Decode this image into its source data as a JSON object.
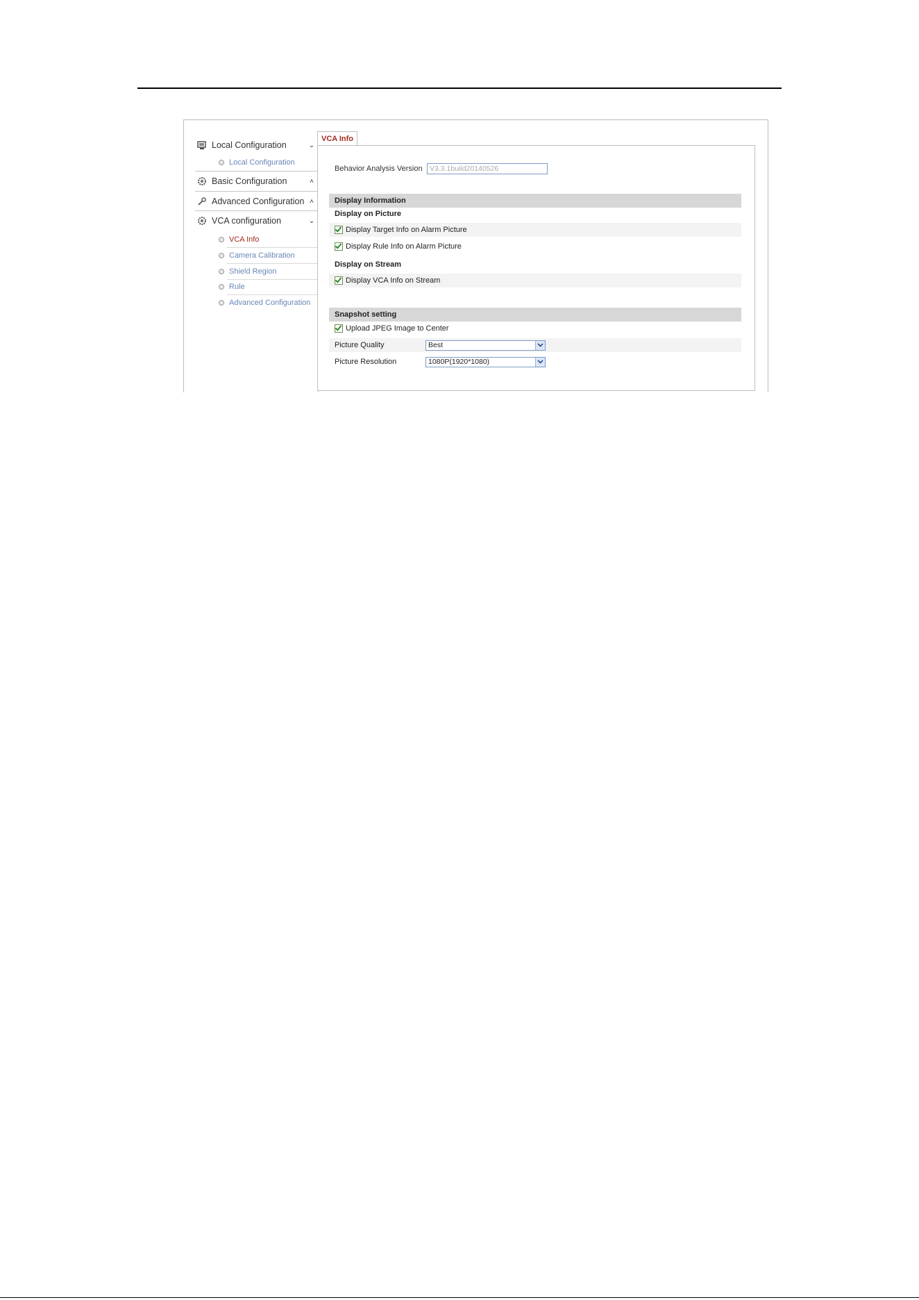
{
  "sidebar": {
    "sections": [
      {
        "label": "Local Configuration",
        "icon": "monitor-icon",
        "chevron": "⌄"
      },
      {
        "label": "Basic Configuration",
        "icon": "gear-icon",
        "chevron": "˄"
      },
      {
        "label": "Advanced Configuration",
        "icon": "wrench-icon",
        "chevron": "˄"
      },
      {
        "label": "VCA configuration",
        "icon": "gear-icon",
        "chevron": "⌄"
      }
    ],
    "local_items": [
      "Local Configuration"
    ],
    "vca_items": [
      "VCA Info",
      "Camera Calibration",
      "Shield Region",
      "Rule",
      "Advanced Configuration"
    ],
    "active_item": "VCA Info"
  },
  "tab": {
    "label": "VCA Info"
  },
  "version": {
    "label": "Behavior Analysis Version",
    "value": "V3.3.1build20140526"
  },
  "display_information": {
    "title": "Display Information",
    "picture_title": "Display on Picture",
    "picture_options": [
      "Display Target Info on Alarm Picture",
      "Display Rule Info on Alarm Picture"
    ],
    "stream_title": "Display on Stream",
    "stream_options": [
      "Display VCA Info on Stream"
    ]
  },
  "snapshot": {
    "title": "Snapshot setting",
    "upload_label": "Upload JPEG Image to Center",
    "quality_label": "Picture Quality",
    "quality_value": "Best",
    "resolution_label": "Picture Resolution",
    "resolution_value": "1080P(1920*1080)"
  },
  "colors": {
    "accent": "#a32a1f",
    "link": "#6a86b8",
    "band": "#d7d7d7"
  }
}
